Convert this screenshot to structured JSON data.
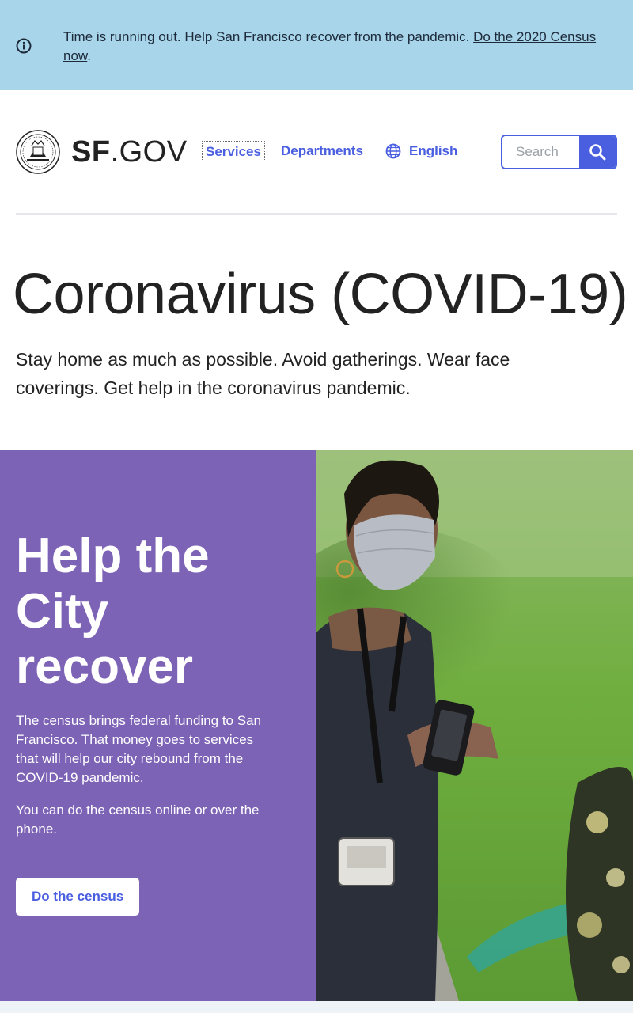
{
  "alert": {
    "message": "Time is running out. Help San Francisco recover from the pandemic. ",
    "link_text": "Do the 2020 Census now",
    "trailing": "."
  },
  "header": {
    "wordmark_bold": "SF",
    "wordmark_light": ".GOV",
    "nav": {
      "services": "Services",
      "departments": "Departments",
      "language": "English"
    },
    "search": {
      "placeholder": "Search"
    }
  },
  "main": {
    "title": "Coronavirus (COVID-19)",
    "intro": "Stay home as much as possible. Avoid gatherings. Wear face coverings. Get help in the coronavirus pandemic."
  },
  "feature": {
    "heading": "Help the City recover",
    "paragraph1": "The census brings federal funding to San Francisco. That money goes to services that will help our city rebound from the COVID-19 pandemic.",
    "paragraph2": "You can do the census online or over the phone.",
    "button": "Do the census"
  },
  "colors": {
    "alert_bg": "#a8d5ea",
    "accent": "#4a5fe0",
    "feature_bg": "#7d63b6"
  },
  "icons": [
    "info-icon",
    "city-seal-logo",
    "globe-icon",
    "search-icon"
  ]
}
